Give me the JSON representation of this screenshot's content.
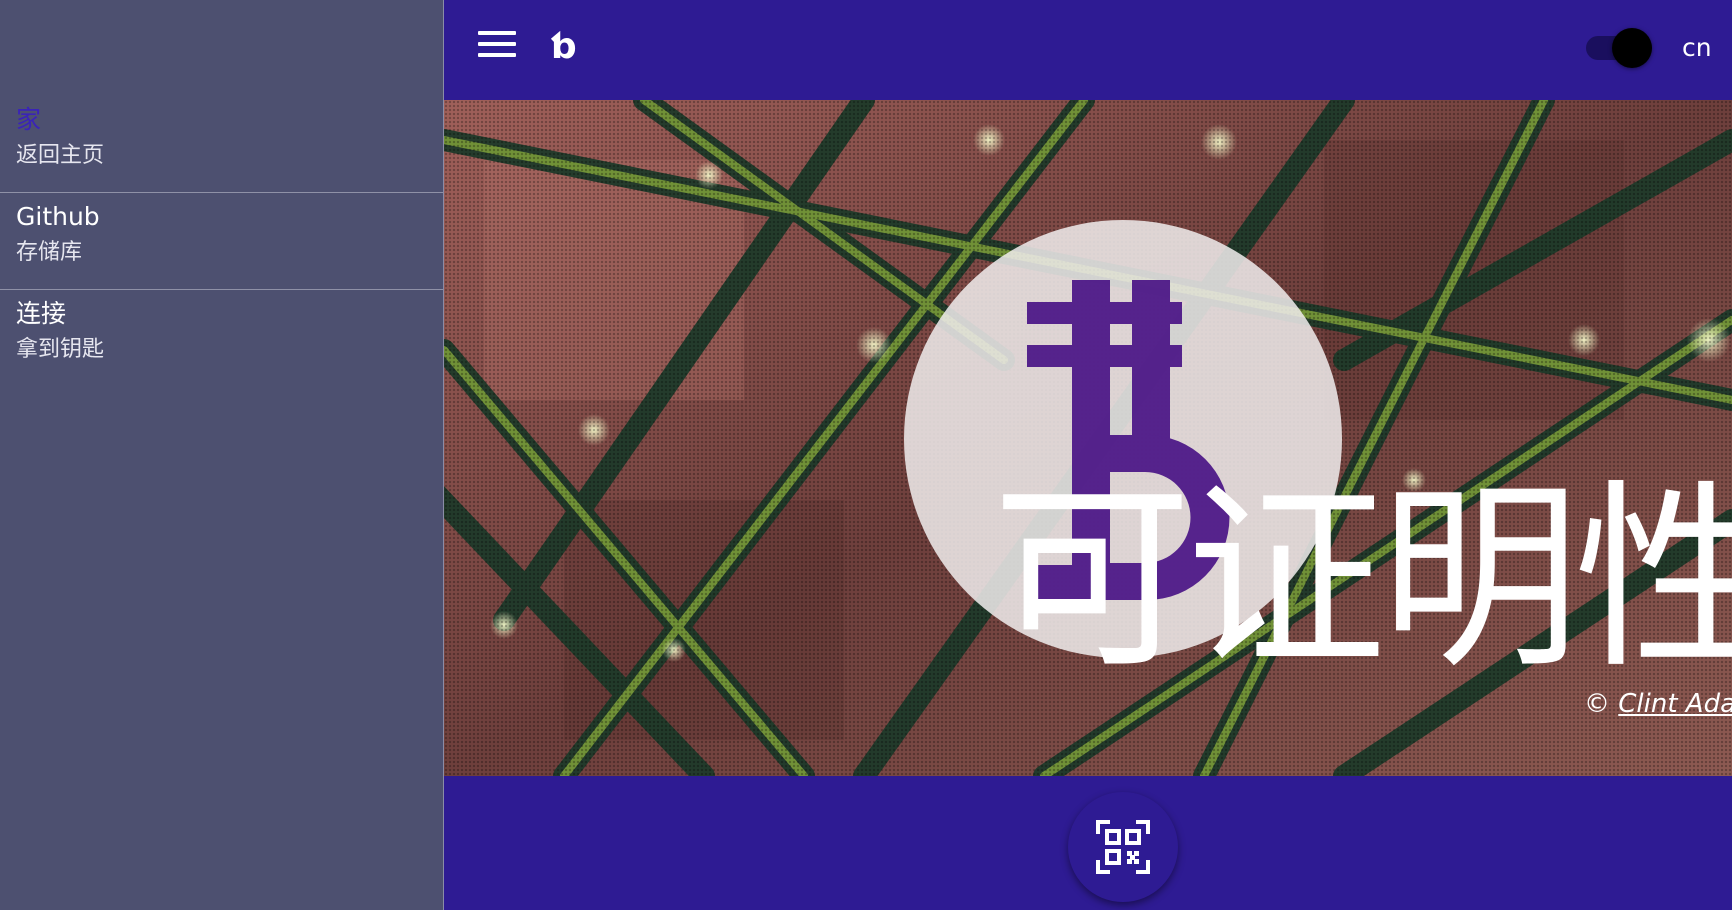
{
  "colors": {
    "primary": "#2e1b93",
    "drawer_bg": "#4d5070",
    "active_item": "#3a23b8",
    "logo_purple": "#4a1486",
    "text": "#ffffff"
  },
  "drawer": {
    "items": [
      {
        "title": "家",
        "subtitle": "返回主页",
        "active": true
      },
      {
        "title": "Github",
        "subtitle": "存储库",
        "active": false
      },
      {
        "title": "连接",
        "subtitle": "拿到钥匙",
        "active": false
      }
    ]
  },
  "topbar": {
    "menu_icon": "hamburger-menu-icon",
    "brand_glyph": "ƅ",
    "theme_toggle_state": "on",
    "lang_label": "cn"
  },
  "hero": {
    "logo_icon": "provable-currency-logo",
    "title": "可证明性",
    "credit_symbol": "©",
    "credit_author": "Clint Ada"
  },
  "bottombar": {
    "fab_icon": "qr-code-scan-icon"
  }
}
